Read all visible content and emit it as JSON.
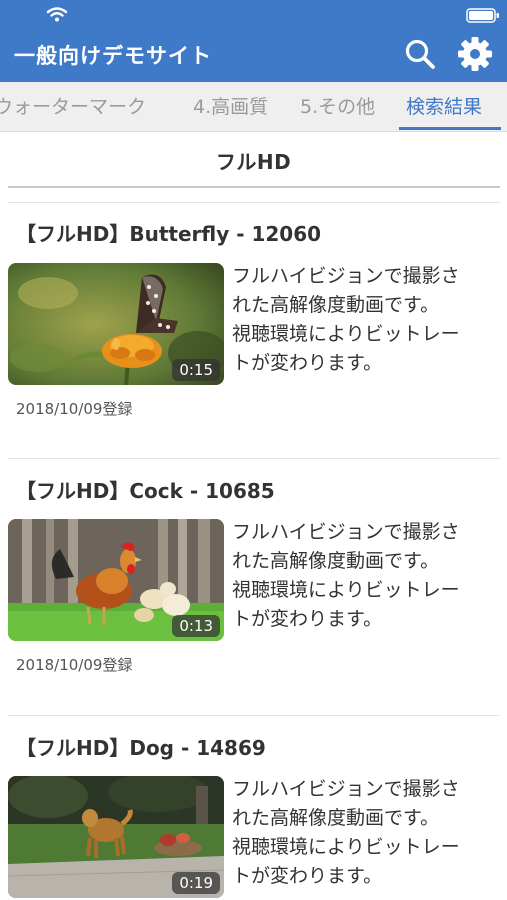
{
  "header": {
    "title": "一般向けデモサイト",
    "accent_color": "#3f7ac8",
    "search_icon": "search-icon",
    "settings_icon": "gear-icon"
  },
  "tabs": [
    {
      "label": "ウォーターマーク",
      "active": false
    },
    {
      "label": "4.高画質",
      "active": false
    },
    {
      "label": "5.その他",
      "active": false
    },
    {
      "label": "検索結果",
      "active": true
    }
  ],
  "section": {
    "title": "フルHD"
  },
  "videos": [
    {
      "title": "【フルHD】Butterfly - 12060",
      "duration": "0:15",
      "description_lines": [
        "フルハイビジョンで撮影さ",
        "れた高解像度動画です。",
        "視聴環境によりビットレー",
        "トが変わります。"
      ],
      "date": "2018/10/09登録"
    },
    {
      "title": "【フルHD】Cock - 10685",
      "duration": "0:13",
      "description_lines": [
        "フルハイビジョンで撮影さ",
        "れた高解像度動画です。",
        "視聴環境によりビットレー",
        "トが変わります。"
      ],
      "date": "2018/10/09登録"
    },
    {
      "title": "【フルHD】Dog - 14869",
      "duration": "0:19",
      "description_lines": [
        "フルハイビジョンで撮影さ",
        "れた高解像度動画です。",
        "視聴環境によりビットレー",
        "トが変わります。"
      ]
    }
  ]
}
